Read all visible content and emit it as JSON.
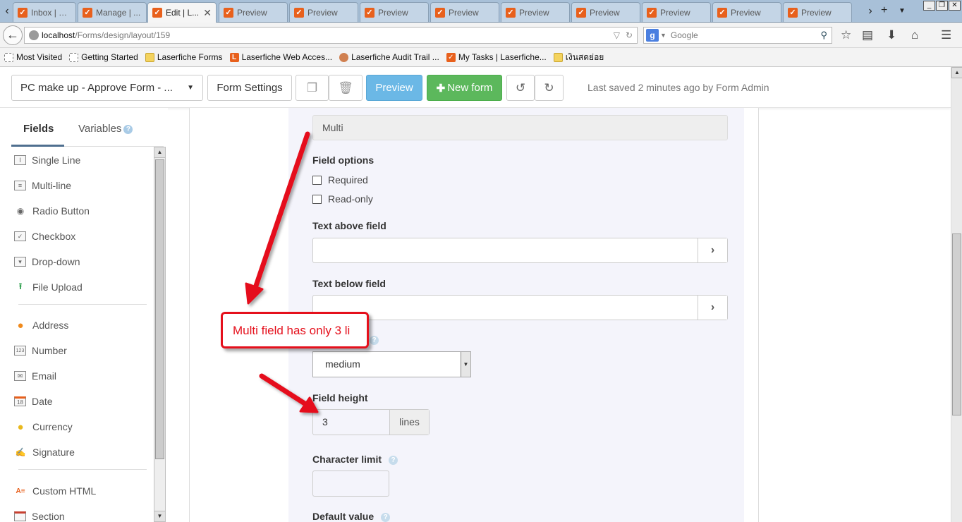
{
  "browser": {
    "tabs": [
      {
        "title": "Inbox | La...",
        "active": false
      },
      {
        "title": "Manage | ...",
        "active": false
      },
      {
        "title": "Edit | L...",
        "active": true
      },
      {
        "title": "Preview",
        "active": false
      },
      {
        "title": "Preview",
        "active": false
      },
      {
        "title": "Preview",
        "active": false
      },
      {
        "title": "Preview",
        "active": false
      },
      {
        "title": "Preview",
        "active": false
      },
      {
        "title": "Preview",
        "active": false
      },
      {
        "title": "Preview",
        "active": false
      },
      {
        "title": "Preview",
        "active": false
      },
      {
        "title": "Preview",
        "active": false
      }
    ],
    "url_host": "localhost",
    "url_path": "/Forms/design/layout/159",
    "search_placeholder": "Google",
    "bookmarks": [
      {
        "label": "Most Visited",
        "icon": "page"
      },
      {
        "label": "Getting Started",
        "icon": "page"
      },
      {
        "label": "Laserfiche Forms",
        "icon": "folder"
      },
      {
        "label": "Laserfiche Web Acces...",
        "icon": "lf"
      },
      {
        "label": "Laserfiche Audit Trail ...",
        "icon": "audit"
      },
      {
        "label": "My Tasks | Laserfiche...",
        "icon": "check"
      },
      {
        "label": "เงินสดย่อย",
        "icon": "folder"
      }
    ]
  },
  "toolbar": {
    "form_name": "PC make up - Approve Form - ...",
    "settings_label": "Form Settings",
    "preview_label": "Preview",
    "new_form_label": "New form",
    "saved_status": "Last saved 2 minutes ago by Form Admin"
  },
  "left_panel": {
    "tabs": {
      "fields": "Fields",
      "variables": "Variables"
    },
    "items": [
      {
        "label": "Single Line",
        "icon": "single-line-icon"
      },
      {
        "label": "Multi-line",
        "icon": "multi-line-icon"
      },
      {
        "label": "Radio Button",
        "icon": "radio-icon"
      },
      {
        "label": "Checkbox",
        "icon": "checkbox-icon"
      },
      {
        "label": "Drop-down",
        "icon": "dropdown-icon"
      },
      {
        "label": "File Upload",
        "icon": "upload-icon"
      },
      {
        "label": "Address",
        "icon": "map-pin-icon"
      },
      {
        "label": "Number",
        "icon": "number-icon"
      },
      {
        "label": "Email",
        "icon": "envelope-icon"
      },
      {
        "label": "Date",
        "icon": "calendar-icon"
      },
      {
        "label": "Currency",
        "icon": "coins-icon"
      },
      {
        "label": "Signature",
        "icon": "signature-icon"
      },
      {
        "label": "Custom HTML",
        "icon": "html-icon"
      },
      {
        "label": "Section",
        "icon": "section-icon"
      }
    ]
  },
  "editor": {
    "field_label_value": "Multi",
    "field_options_label": "Field options",
    "required_label": "Required",
    "readonly_label": "Read-only",
    "text_above_label": "Text above field",
    "text_below_label": "Text below field",
    "field_width_value": "medium",
    "field_height_label": "Field height",
    "field_height_value": "3",
    "field_height_unit": "lines",
    "char_limit_label": "Character limit",
    "default_value_label": "Default value"
  },
  "annotation": {
    "callout_text": "Multi field has only 3 li",
    "color": "#e5101c"
  }
}
